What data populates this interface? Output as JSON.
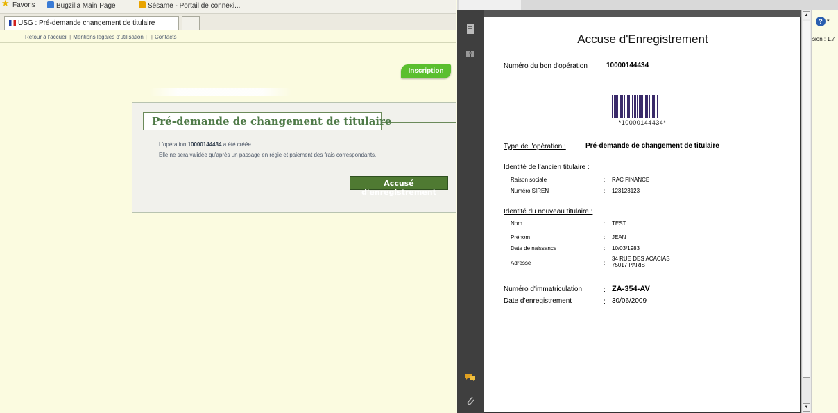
{
  "browser": {
    "favorites_label": "Favoris",
    "favorites": [
      "Bugzilla Main Page",
      "Sésame - Portail de connexi..."
    ],
    "tab_title": "USG : Pré-demande changement de titulaire"
  },
  "nav": {
    "home": "Retour à l'accueil",
    "legal": "Mentions légales d'utilisation",
    "contacts": "Contacts"
  },
  "inscription_label": "Inscription",
  "panel": {
    "title": "Pré-demande de changement de titulaire",
    "line1_prefix": "L'opération ",
    "line1_op": "10000144434",
    "line1_suffix": " a été créée.",
    "line2": "Elle ne sera validée qu'après un passage en régie et paiement des frais correspondants.",
    "button": "Accusé d'enregistrement"
  },
  "pdf": {
    "title": "Accuse d'Enregistrement",
    "op_label": "Numéro du bon d'opération",
    "op_value": "10000144434",
    "barcode_text": "*10000144434*",
    "type_label": "Type de l'opération :",
    "type_value": "Pré-demande de changement de titulaire",
    "old_header": "Identité de l'ancien titulaire :",
    "old_rows": [
      {
        "label": "Raison sociale",
        "value": "RAC FINANCE"
      },
      {
        "label": "Numéro SIREN",
        "value": "123123123"
      }
    ],
    "new_header": "Identité du nouveau titulaire :",
    "new_rows": [
      {
        "label": "Nom",
        "value": "TEST"
      },
      {
        "label": "Prénom",
        "value": "JEAN"
      },
      {
        "label": "Date de naissance",
        "value": "10/03/1983"
      },
      {
        "label": "Adresse",
        "value": "34 RUE DES ACACIAS",
        "value2": "75017 PARIS"
      }
    ],
    "immat_label": "Numéro d'immatriculation",
    "immat_value": "ZA-354-AV",
    "date_label": "Date d'enregistrement",
    "date_value": "30/06/2009",
    "colon": ":"
  },
  "viewer": {
    "version_text": "sion : 1.7",
    "help_glyph": "?",
    "help_arrow": "▾",
    "scroll_up": "▲",
    "scroll_down": "▼"
  },
  "colors": {
    "page_bg": "#fbfbe0",
    "green_title": "#4f7a48",
    "button_green": "#4f7a32",
    "inscription_green": "#5bbf2f"
  }
}
